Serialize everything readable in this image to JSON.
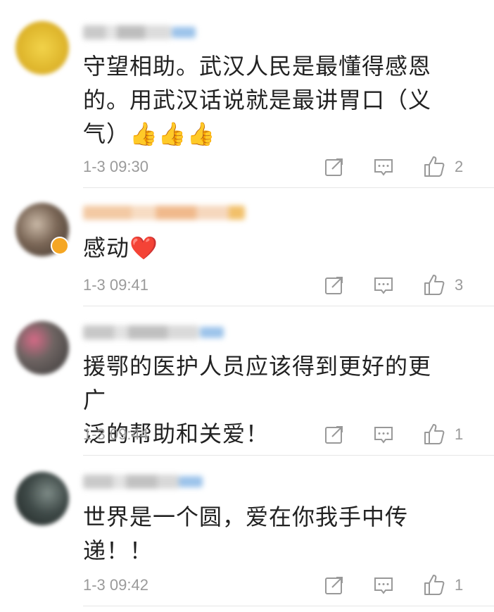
{
  "comments": [
    {
      "text_lines": [
        "守望相助。武汉人民是最懂得感恩",
        "的。用武汉话说就是最讲胃口（义",
        "气）👍👍👍"
      ],
      "time": "1-3 09:30",
      "likes": "2",
      "avatar_color": "#e8c53a"
    },
    {
      "text_lines": [
        "感动❤️"
      ],
      "time": "1-3 09:41",
      "likes": "3",
      "avatar_color": "#6b5a4a"
    },
    {
      "text_lines": [
        "援鄂的医护人员应该得到更好的更广",
        "泛的帮助和关爱！"
      ],
      "time": "1-3 09:44",
      "likes": "1",
      "avatar_color": "#5d5a58"
    },
    {
      "text_lines": [
        "世界是一个圆，爱在你我手中传",
        "递！！"
      ],
      "time": "1-3 09:42",
      "likes": "1",
      "avatar_color": "#3f4a48"
    }
  ],
  "icons": {
    "forward": "share-icon",
    "comment": "comment-icon",
    "like": "thumbs-up-icon"
  }
}
